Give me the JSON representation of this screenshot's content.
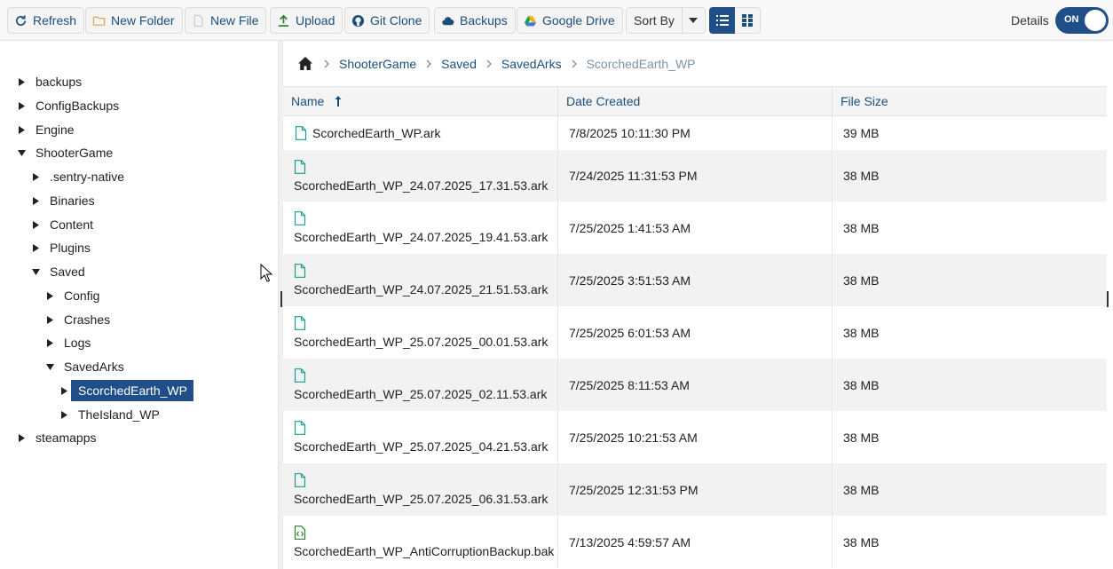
{
  "toolbar": {
    "refresh": "Refresh",
    "new_folder": "New Folder",
    "new_file": "New File",
    "upload": "Upload",
    "git_clone": "Git Clone",
    "backups": "Backups",
    "google_drive": "Google Drive",
    "sort_by": "Sort By",
    "details_label": "Details",
    "details_toggle": "ON"
  },
  "tree": {
    "items": [
      {
        "label": "backups",
        "depth": 0,
        "expanded": false
      },
      {
        "label": "ConfigBackups",
        "depth": 0,
        "expanded": false
      },
      {
        "label": "Engine",
        "depth": 0,
        "expanded": false
      },
      {
        "label": "ShooterGame",
        "depth": 0,
        "expanded": true
      },
      {
        "label": ".sentry-native",
        "depth": 1,
        "expanded": false
      },
      {
        "label": "Binaries",
        "depth": 1,
        "expanded": false
      },
      {
        "label": "Content",
        "depth": 1,
        "expanded": false
      },
      {
        "label": "Plugins",
        "depth": 1,
        "expanded": false
      },
      {
        "label": "Saved",
        "depth": 1,
        "expanded": true
      },
      {
        "label": "Config",
        "depth": 2,
        "expanded": false
      },
      {
        "label": "Crashes",
        "depth": 2,
        "expanded": false
      },
      {
        "label": "Logs",
        "depth": 2,
        "expanded": false
      },
      {
        "label": "SavedArks",
        "depth": 2,
        "expanded": true
      },
      {
        "label": "ScorchedEarth_WP",
        "depth": 3,
        "expanded": false,
        "selected": true
      },
      {
        "label": "TheIsland_WP",
        "depth": 3,
        "expanded": false
      },
      {
        "label": "steamapps",
        "depth": 0,
        "expanded": false
      }
    ]
  },
  "breadcrumb": {
    "items": [
      "ShooterGame",
      "Saved",
      "SavedArks"
    ],
    "current": "ScorchedEarth_WP"
  },
  "grid": {
    "columns": {
      "name": "Name",
      "date": "Date Created",
      "size": "File Size"
    },
    "rows": [
      {
        "name": "ScorchedEarth_WP.ark",
        "date": "7/8/2025 10:11:30 PM",
        "size": "39 MB",
        "icon": "file-icon"
      },
      {
        "name": "ScorchedEarth_WP_24.07.2025_17.31.53.ark",
        "date": "7/24/2025 11:31:53 PM",
        "size": "38 MB",
        "icon": "file-icon"
      },
      {
        "name": "ScorchedEarth_WP_24.07.2025_19.41.53.ark",
        "date": "7/25/2025 1:41:53 AM",
        "size": "38 MB",
        "icon": "file-icon"
      },
      {
        "name": "ScorchedEarth_WP_24.07.2025_21.51.53.ark",
        "date": "7/25/2025 3:51:53 AM",
        "size": "38 MB",
        "icon": "file-icon"
      },
      {
        "name": "ScorchedEarth_WP_25.07.2025_00.01.53.ark",
        "date": "7/25/2025 6:01:53 AM",
        "size": "38 MB",
        "icon": "file-icon"
      },
      {
        "name": "ScorchedEarth_WP_25.07.2025_02.11.53.ark",
        "date": "7/25/2025 8:11:53 AM",
        "size": "38 MB",
        "icon": "file-icon"
      },
      {
        "name": "ScorchedEarth_WP_25.07.2025_04.21.53.ark",
        "date": "7/25/2025 10:21:53 AM",
        "size": "38 MB",
        "icon": "file-icon"
      },
      {
        "name": "ScorchedEarth_WP_25.07.2025_06.31.53.ark",
        "date": "7/25/2025 12:31:53 PM",
        "size": "38 MB",
        "icon": "file-icon"
      },
      {
        "name": "ScorchedEarth_WP_AntiCorruptionBackup.bak",
        "date": "7/13/2025 4:59:57 AM",
        "size": "38 MB",
        "icon": "code-file-icon"
      }
    ]
  },
  "colors": {
    "accent": "#1f4f86",
    "link": "#1a4f7c",
    "file_icon": "#1a9e8c",
    "code_icon": "#2e7d32"
  }
}
